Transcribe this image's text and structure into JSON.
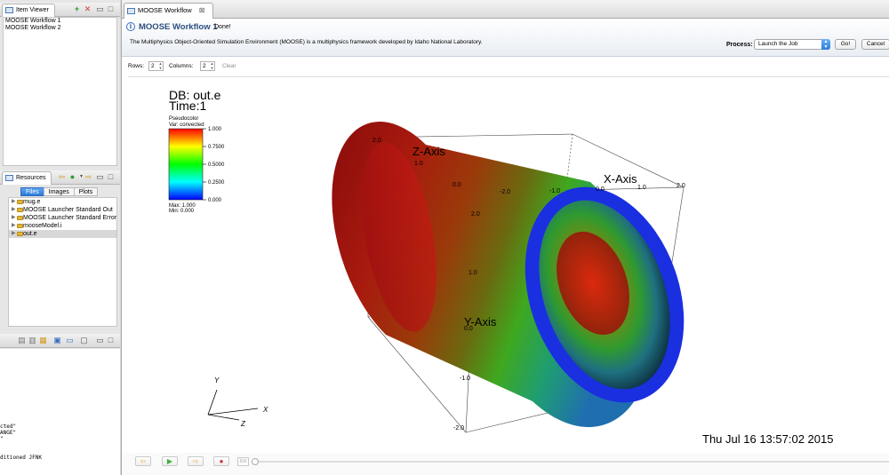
{
  "item_viewer": {
    "tab_label": "Item Viewer",
    "items": [
      "MOOSE Workflow 1",
      "MOOSE Workflow 2"
    ]
  },
  "resources": {
    "tab_label": "Resources",
    "tabs": [
      "Files",
      "Images",
      "Plots"
    ],
    "selected_tab": "Files",
    "files": [
      "mug.e",
      "MOOSE Launcher Standard Out",
      "MOOSE Launcher Standard Error",
      "mooseModel.i",
      "out.e"
    ],
    "selected_file": "out.e"
  },
  "console": {
    "lines": [
      "cted\"",
      "ANGE\"",
      "\"",
      "",
      "",
      "ditioned JFNK"
    ]
  },
  "editor": {
    "tab_label": "MOOSE Workflow",
    "tab_close": "⊠",
    "title": "MOOSE Workflow 1",
    "status": "Done!",
    "description": "The Multiphysics Object-Oriented Simulation Environment (MOOSE) is a multiphysics framework developed by Idaho National Laboratory.",
    "process_label": "Process:",
    "process_value": "Launch the Job",
    "go_button": "Go!",
    "cancel_button": "Cancel"
  },
  "grid": {
    "rows_label": "Rows:",
    "rows_value": "2",
    "columns_label": "Columns:",
    "columns_value": "2",
    "clear_label": "Clear"
  },
  "visit": {
    "db_label": "DB: out.e",
    "time_label": "Time:1",
    "legend": {
      "plot_type": "Pseudocolor",
      "variable": "Var: convected",
      "ticks": [
        "1.000",
        "0.7500",
        "0.5000",
        "0.2500",
        "0.000"
      ],
      "max": "Max:  1.000",
      "min": "Min:  0.000"
    },
    "axes": {
      "x_title": "X-Axis",
      "y_title": "Y-Axis",
      "z_title": "Z-Axis",
      "x_ticks": [
        "-2.0",
        "-1.0",
        "0.0",
        "1.0",
        "2.0"
      ],
      "y_ticks": [
        "2.0",
        "1.0",
        "0.0",
        "-1.0",
        "-2.0"
      ],
      "z_ticks": [
        "2.0",
        "1.0",
        "0.0",
        "-1.0",
        "-2.0"
      ],
      "triad_x": "X",
      "triad_y": "Y",
      "triad_z": "Z"
    },
    "timestamp": "Thu Jul 16 13:57:02 2015",
    "colors": {
      "colormap": [
        "#ff0000",
        "#ffff00",
        "#00ff00",
        "#00ffff",
        "#0000ff"
      ],
      "ring": "#1a2fe0"
    }
  },
  "playbar": {
    "frame_value": "0.0"
  }
}
